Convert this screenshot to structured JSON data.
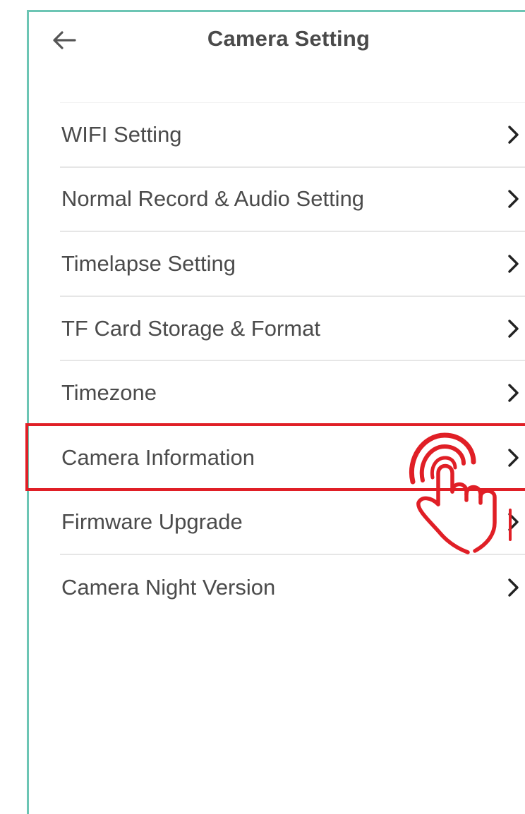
{
  "header": {
    "title": "Camera Setting",
    "back_icon": "arrow-left-icon"
  },
  "menu": {
    "items": [
      {
        "label": "WIFI Setting"
      },
      {
        "label": "Normal Record & Audio Setting"
      },
      {
        "label": "Timelapse Setting"
      },
      {
        "label": "TF Card Storage & Format"
      },
      {
        "label": "Timezone"
      },
      {
        "label": "Camera Information"
      },
      {
        "label": "Firmware Upgrade"
      },
      {
        "label": "Camera Night Version"
      }
    ],
    "chevron_icon": "chevron-right-icon"
  },
  "annotation": {
    "highlighted_item": "Camera Information",
    "highlight_color": "#e01f26",
    "pointer_icon": "tap-hand-icon"
  },
  "colors": {
    "frame_border": "#6cc5b4",
    "text": "#4b4b4b",
    "divider": "#e6e6e6"
  }
}
